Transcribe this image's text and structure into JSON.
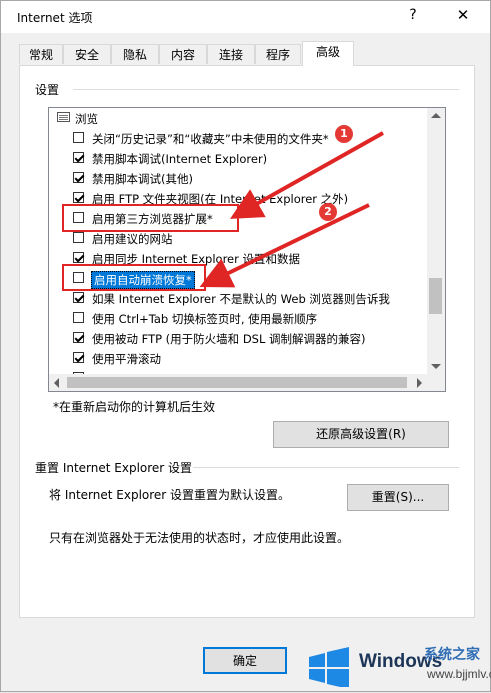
{
  "window": {
    "title": "Internet 选项",
    "help_glyph": "?",
    "close_glyph": "✕"
  },
  "tabs": [
    "常规",
    "安全",
    "隐私",
    "内容",
    "连接",
    "程序",
    "高级"
  ],
  "active_tab": "高级",
  "settings": {
    "group_label": "设置",
    "category": "浏览",
    "items": [
      {
        "label": "关闭“历史记录”和“收藏夹”中未使用的文件夹*",
        "checked": false
      },
      {
        "label": "禁用脚本调试(Internet Explorer)",
        "checked": true
      },
      {
        "label": "禁用脚本调试(其他)",
        "checked": true
      },
      {
        "label": "启用 FTP 文件夹视图(在 Internet Explorer 之外)",
        "checked": true
      },
      {
        "label": "启用第三方浏览器扩展*",
        "checked": false
      },
      {
        "label": "启用建议的网站",
        "checked": false
      },
      {
        "label": "启用同步 Internet Explorer 设置和数据",
        "checked": true
      },
      {
        "label": "启用自动崩溃恢复*",
        "checked": false,
        "highlighted": true
      },
      {
        "label": "如果 Internet Explorer 不是默认的 Web 浏览器则告诉我",
        "checked": true
      },
      {
        "label": "使用 Ctrl+Tab 切换标签页时, 使用最新顺序",
        "checked": false
      },
      {
        "label": "使用被动 FTP (用于防火墙和 DSL 调制解调器的兼容)",
        "checked": true
      },
      {
        "label": "使用平滑滚动",
        "checked": true
      },
      {
        "label": "...",
        "checked": false
      }
    ],
    "restart_note": "*在重新启动你的计算机后生效",
    "restore_button": "还原高级设置(R)"
  },
  "reset": {
    "group_label": "重置 Internet Explorer 设置",
    "description": "将 Internet Explorer 设置重置为默认设置。",
    "button": "重置(S)...",
    "hint": "只有在浏览器处于无法使用的状态时，才应使用此设置。"
  },
  "footer": {
    "ok_button": "确定"
  },
  "annotations": {
    "badge_1": "1",
    "badge_2": "2",
    "color": "#e02525"
  },
  "watermark": {
    "brand": "Windows",
    "site": "系统之家",
    "url": "www.bjjmlv.com"
  }
}
